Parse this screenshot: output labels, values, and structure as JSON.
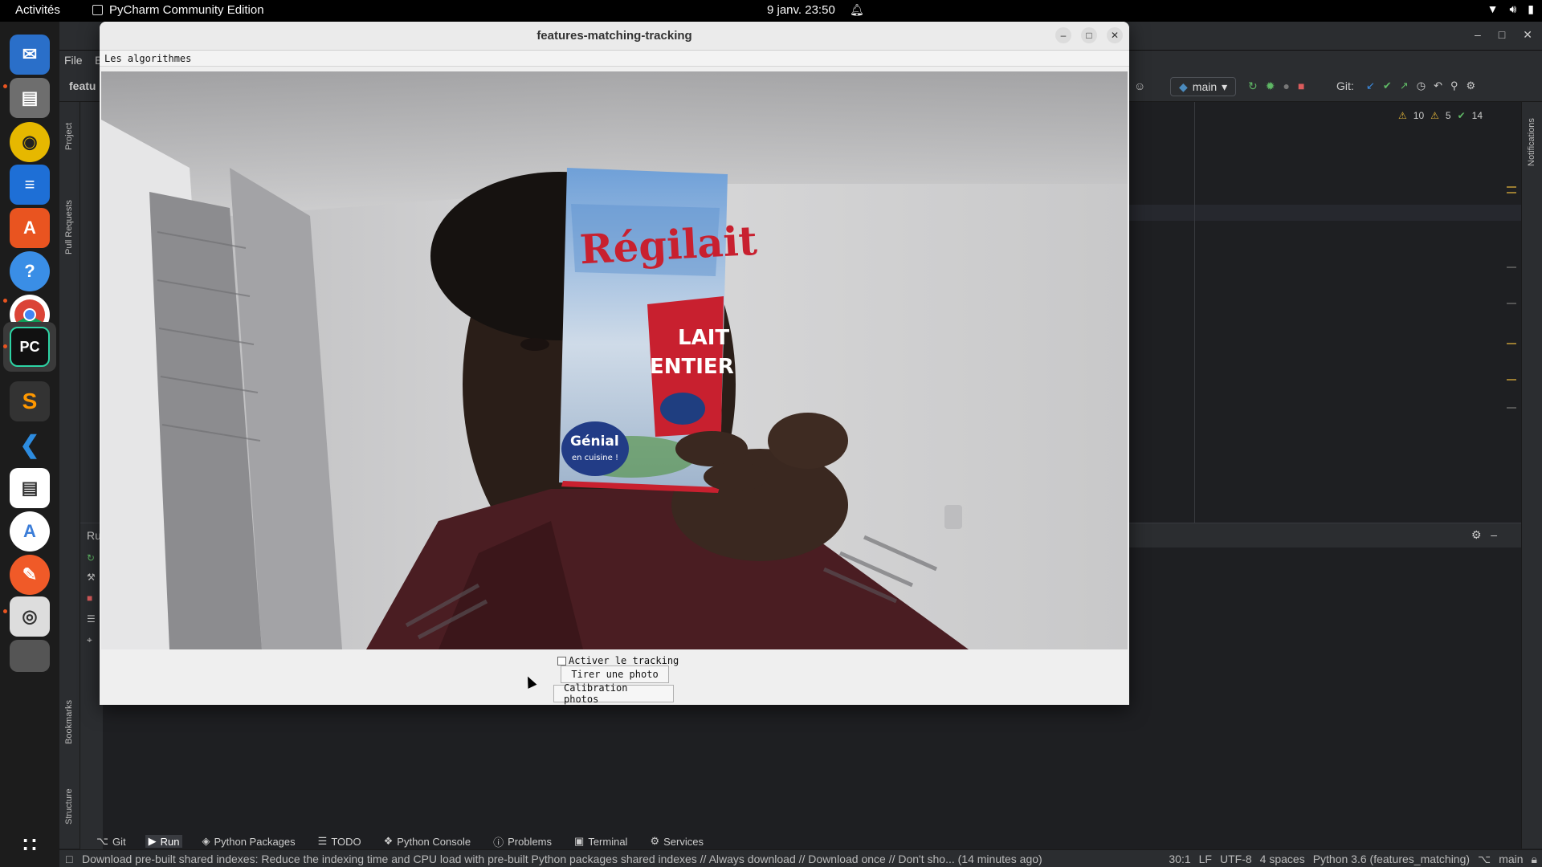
{
  "topbar": {
    "activities": "Activités",
    "app_name": "PyCharm Community Edition",
    "clock": "9 janv.  23:50"
  },
  "dock": {
    "icons": [
      "thunderbird-icon",
      "files-icon",
      "rhythmbox-icon",
      "libreoffice-writer-icon",
      "app-center-icon",
      "help-icon",
      "chrome-icon",
      "pycharm-icon",
      "sublime-text-icon",
      "vscode-icon",
      "notes-icon",
      "android-studio-icon",
      "pen-icon",
      "search-tool-icon",
      "drive-icon",
      "app-grid-icon"
    ]
  },
  "ide": {
    "menu_file": "File",
    "menu_edit_partial": "E",
    "project_partial": "featu",
    "branch": "main",
    "git_label": "Git:",
    "inspections": {
      "warnings": "10",
      "weak_warnings": "5",
      "ok": "14"
    },
    "run_label": "Run",
    "left_labels": {
      "project": "Project",
      "pull_requests": "Pull Requests",
      "bookmarks": "Bookmarks",
      "structure": "Structure"
    },
    "right_label": "Notifications",
    "tool_tabs": [
      {
        "label": "Git",
        "icon": "git-icon"
      },
      {
        "label": "Run",
        "icon": "run-icon"
      },
      {
        "label": "Python Packages",
        "icon": "packages-icon"
      },
      {
        "label": "TODO",
        "icon": "todo-icon"
      },
      {
        "label": "Python Console",
        "icon": "console-icon"
      },
      {
        "label": "Problems",
        "icon": "problems-icon"
      },
      {
        "label": "Terminal",
        "icon": "terminal-icon"
      },
      {
        "label": "Services",
        "icon": "services-icon"
      }
    ],
    "status_message": "Download pre-built shared indexes: Reduce the indexing time and CPU load with pre-built Python packages shared indexes // Always download // Download once // Don't sho... (14 minutes ago)",
    "status_right": {
      "position": "30:1",
      "line_sep": "LF",
      "encoding": "UTF-8",
      "indent": "4 spaces",
      "interpreter": "Python 3.6 (features_matching)",
      "branch": "main"
    }
  },
  "appwin": {
    "title": "features-matching-tracking",
    "menu": "Les algorithmes",
    "checkbox_label": "Activer le tracking",
    "checkbox_checked": false,
    "btn_photo": "Tirer une photo",
    "btn_calib": "Calibration photos",
    "carton": {
      "brand": "Régilait",
      "line1": "LAIT",
      "line2": "ENTIER",
      "badge": "Génial",
      "badge_sub": "en cuisine !"
    }
  }
}
